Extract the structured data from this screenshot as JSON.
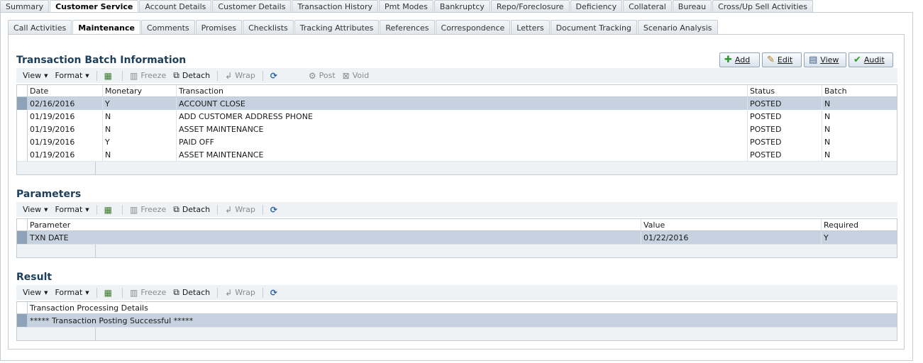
{
  "top_tabs": [
    "Summary",
    "Customer Service",
    "Account Details",
    "Customer Details",
    "Transaction History",
    "Pmt Modes",
    "Bankruptcy",
    "Repo/Foreclosure",
    "Deficiency",
    "Collateral",
    "Bureau",
    "Cross/Up Sell Activities"
  ],
  "top_tabs_active": 1,
  "sub_tabs": [
    "Call Activities",
    "Maintenance",
    "Comments",
    "Promises",
    "Checklists",
    "Tracking Attributes",
    "References",
    "Correspondence",
    "Letters",
    "Document Tracking",
    "Scenario Analysis"
  ],
  "sub_tabs_active": 1,
  "actions": {
    "add": "Add",
    "edit": "Edit",
    "view": "View",
    "audit": "Audit"
  },
  "toolbar": {
    "view": "View",
    "format": "Format",
    "freeze": "Freeze",
    "detach": "Detach",
    "wrap": "Wrap",
    "post": "Post",
    "void": "Void"
  },
  "batch": {
    "title": "Transaction Batch Information",
    "columns": [
      "Date",
      "Monetary",
      "Transaction",
      "Status",
      "Batch"
    ],
    "rows": [
      [
        "02/16/2016",
        "Y",
        "ACCOUNT CLOSE",
        "POSTED",
        "N"
      ],
      [
        "01/19/2016",
        "N",
        "ADD CUSTOMER ADDRESS PHONE",
        "POSTED",
        "N"
      ],
      [
        "01/19/2016",
        "N",
        "ASSET MAINTENANCE",
        "POSTED",
        "N"
      ],
      [
        "01/19/2016",
        "Y",
        "PAID OFF",
        "POSTED",
        "N"
      ],
      [
        "01/19/2016",
        "N",
        "ASSET MAINTENANCE",
        "POSTED",
        "N"
      ]
    ]
  },
  "parameters": {
    "title": "Parameters",
    "columns": [
      "Parameter",
      "Value",
      "Required"
    ],
    "rows": [
      [
        "TXN DATE",
        "01/22/2016",
        "Y"
      ]
    ]
  },
  "result": {
    "title": "Result",
    "columns": [
      "Transaction Processing Details"
    ],
    "rows": [
      [
        "***** Transaction Posting Successful *****"
      ]
    ]
  }
}
